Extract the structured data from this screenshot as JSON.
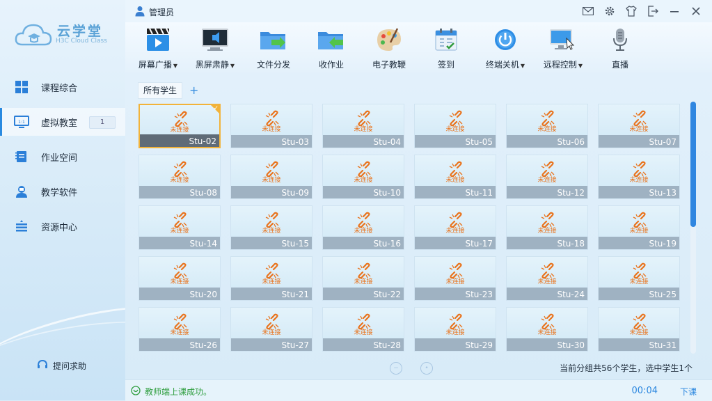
{
  "app": {
    "logo_title": "云学堂",
    "logo_subtitle": "H3C Cloud Class"
  },
  "sidebar": {
    "items": [
      {
        "label": "课程综合",
        "icon": "windows-grid-icon"
      },
      {
        "label": "虚拟教室",
        "icon": "monitor-icon",
        "badge": "1",
        "active": true
      },
      {
        "label": "作业空间",
        "icon": "notebook-icon"
      },
      {
        "label": "教学软件",
        "icon": "user-software-icon"
      },
      {
        "label": "资源中心",
        "icon": "stack-icon"
      }
    ],
    "help_label": "提问求助"
  },
  "titlebar": {
    "user_label": "管理员"
  },
  "toolbar": {
    "items": [
      {
        "label": "屏幕广播",
        "icon": "broadcast-icon",
        "dropdown": true
      },
      {
        "label": "黑屏肃静",
        "icon": "black-screen-icon",
        "dropdown": true
      },
      {
        "label": "文件分发",
        "icon": "file-send-icon",
        "dropdown": false
      },
      {
        "label": "收作业",
        "icon": "collect-homework-icon",
        "dropdown": false
      },
      {
        "label": "电子教鞭",
        "icon": "palette-icon",
        "dropdown": false
      },
      {
        "label": "签到",
        "icon": "calendar-checkin-icon",
        "dropdown": false
      },
      {
        "label": "终端关机",
        "icon": "power-icon",
        "dropdown": true
      },
      {
        "label": "远程控制",
        "icon": "remote-monitor-icon",
        "dropdown": true
      },
      {
        "label": "直播",
        "icon": "microphone-icon",
        "dropdown": false
      }
    ]
  },
  "content": {
    "tab_label": "所有学生",
    "tab_add": "+",
    "status_label": "未连接",
    "students": [
      "Stu-02",
      "Stu-03",
      "Stu-04",
      "Stu-05",
      "Stu-06",
      "Stu-07",
      "Stu-08",
      "Stu-09",
      "Stu-10",
      "Stu-11",
      "Stu-12",
      "Stu-13",
      "Stu-14",
      "Stu-15",
      "Stu-16",
      "Stu-17",
      "Stu-18",
      "Stu-19",
      "Stu-20",
      "Stu-21",
      "Stu-22",
      "Stu-23",
      "Stu-24",
      "Stu-25",
      "Stu-26",
      "Stu-27",
      "Stu-28",
      "Stu-29",
      "Stu-30",
      "Stu-31"
    ],
    "selected_index": 0,
    "summary": "当前分组共56个学生，选中学生1个"
  },
  "statusbar": {
    "message": "教师端上课成功。",
    "timer": "00:04",
    "end_label": "下课"
  },
  "colors": {
    "accent": "#2a86df",
    "status_orange": "#e9731c",
    "success_green": "#2f9e3f",
    "selected_border": "#f2b33a"
  }
}
